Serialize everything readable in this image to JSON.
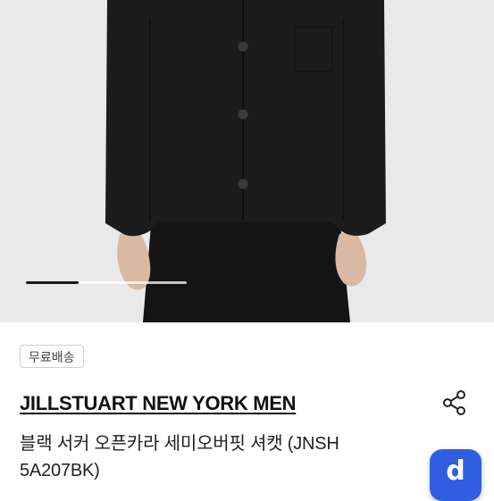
{
  "carousel": {
    "progress": 0.33
  },
  "badge": {
    "label": "무료배송"
  },
  "product": {
    "brand": "JILLSTUART NEW YORK MEN",
    "title_line1": "블랙 서커 오픈카라 세미오버핏 셔캣 (JNSH",
    "title_line2": "5A207BK)"
  },
  "icons": {
    "share": "share-icon",
    "app": "app-launcher-icon"
  },
  "app_button": {
    "glyph": "d"
  },
  "colors": {
    "accent": "#2f5fe0",
    "image_bg": "#e9e9e9",
    "garment": "#1c1c1c"
  }
}
